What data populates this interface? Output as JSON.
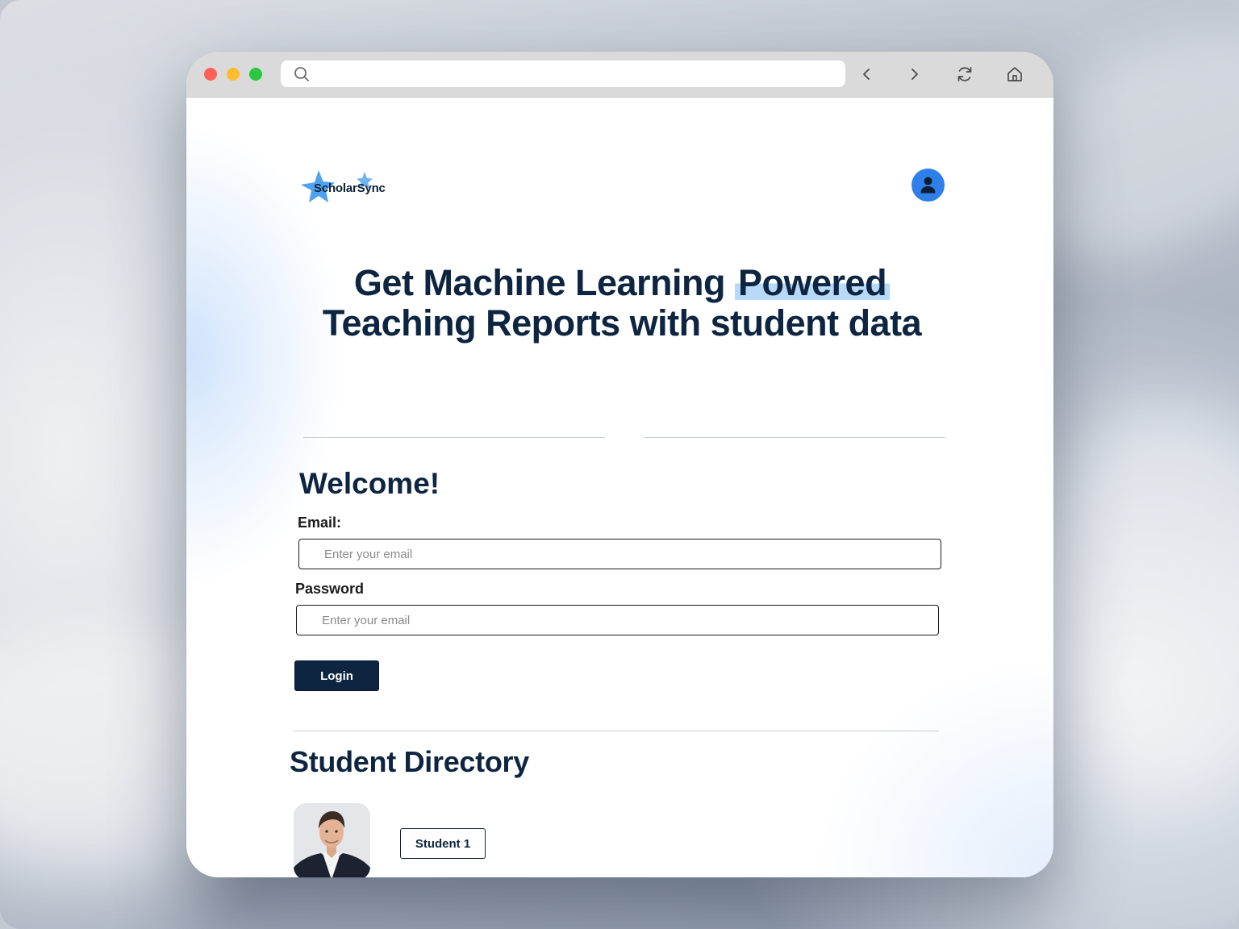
{
  "browser": {
    "url": "",
    "icons": {
      "search": "search-icon",
      "back": "chevron-left-icon",
      "forward": "chevron-right-icon",
      "reload": "reload-icon",
      "home": "home-icon"
    }
  },
  "header": {
    "logo_text": "ScholarSync",
    "avatar_icon": "user-icon"
  },
  "hero": {
    "line1_pre": "Get Machine Learning ",
    "line1_highlight": "Powered",
    "line2": "Teaching Reports with student data"
  },
  "login": {
    "welcome": "Welcome!",
    "email_label": "Email:",
    "email_placeholder": "Enter your email",
    "password_label": "Password",
    "password_placeholder": "Enter your email",
    "login_button": "Login"
  },
  "directory": {
    "title": "Student Directory",
    "students": [
      {
        "button_label": "Student 1"
      }
    ]
  },
  "colors": {
    "primary": "#0d2540",
    "accent": "#2f7fea",
    "highlight": "#b8d9f7"
  }
}
